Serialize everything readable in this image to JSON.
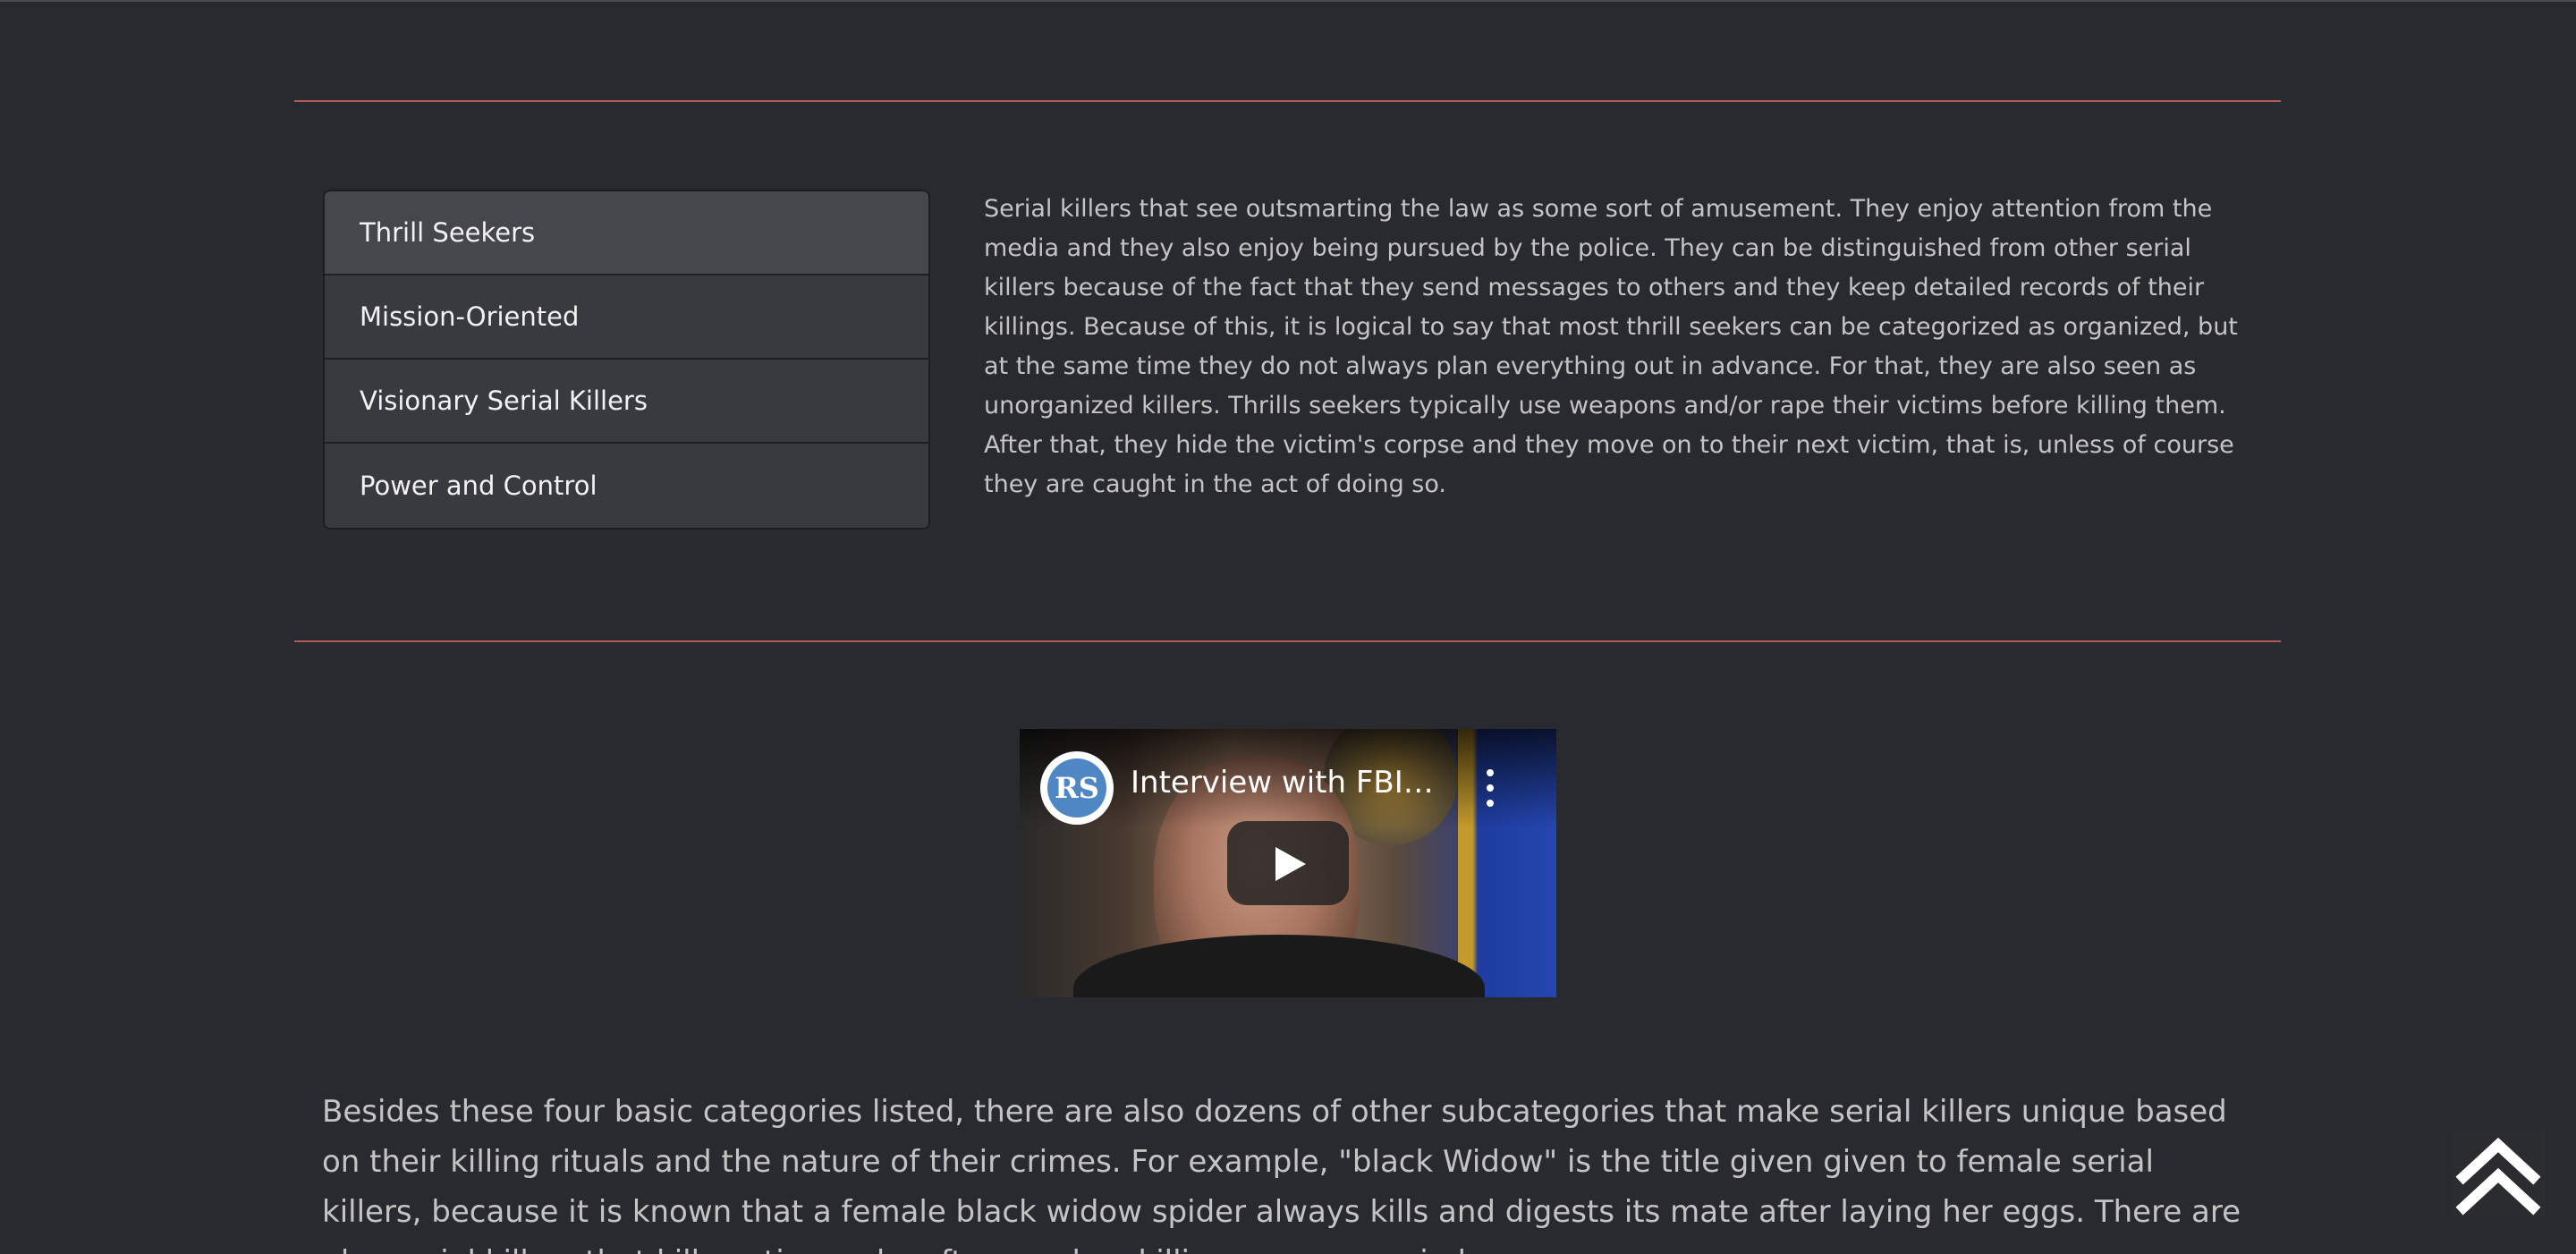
{
  "tabs": [
    {
      "label": "Thrill Seekers"
    },
    {
      "label": "Mission-Oriented"
    },
    {
      "label": "Visionary Serial Killers"
    },
    {
      "label": "Power and Control"
    }
  ],
  "active_tab_content": "Serial killers that see outsmarting the law as some sort of amusement. They enjoy attention from the media and they also enjoy being pursued by the police. They can be distinguished from other serial killers because of the fact that they send messages to others and they keep detailed records of their killings. Because of this, it is logical to say that most thrill seekers can be categorized as organized, but at the same time they do not always plan everything out in advance. For that, they are also seen as unorganized killers. Thrills seekers typically use weapons and/or rape their victims before killing them. After that, they hide the victim's corpse and they move on to their next victim, that is, unless of course they are caught in the act of doing so.",
  "video": {
    "title": "Interview with FBI S...",
    "channel_initials": "RS"
  },
  "body_text": "Besides these four basic categories listed, there are also dozens of other subcategories that make serial killers unique based on their killing rituals and the nature of their crimes. For example, \"black Widow\" is the title given given to female serial killers, because it is known that a female black widow spider always kills and digests its mate after laying her eggs. There are also serial killers that kill continuously, often random killings, over a period...",
  "icons": {
    "scroll_top": "double-chevron-up-icon",
    "video_menu": "more-vertical-icon",
    "play": "play-icon"
  },
  "colors": {
    "background": "#292a2f",
    "divider": "#b5585a",
    "tab_active": "#45474d",
    "tab": "#383a3f"
  }
}
